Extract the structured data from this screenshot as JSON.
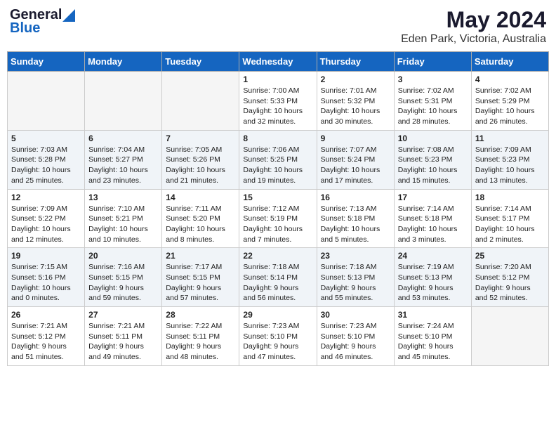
{
  "logo": {
    "general": "General",
    "blue": "Blue"
  },
  "title": "May 2024",
  "subtitle": "Eden Park, Victoria, Australia",
  "weekdays": [
    "Sunday",
    "Monday",
    "Tuesday",
    "Wednesday",
    "Thursday",
    "Friday",
    "Saturday"
  ],
  "weeks": [
    [
      {
        "day": "",
        "info": ""
      },
      {
        "day": "",
        "info": ""
      },
      {
        "day": "",
        "info": ""
      },
      {
        "day": "1",
        "info": "Sunrise: 7:00 AM\nSunset: 5:33 PM\nDaylight: 10 hours\nand 32 minutes."
      },
      {
        "day": "2",
        "info": "Sunrise: 7:01 AM\nSunset: 5:32 PM\nDaylight: 10 hours\nand 30 minutes."
      },
      {
        "day": "3",
        "info": "Sunrise: 7:02 AM\nSunset: 5:31 PM\nDaylight: 10 hours\nand 28 minutes."
      },
      {
        "day": "4",
        "info": "Sunrise: 7:02 AM\nSunset: 5:29 PM\nDaylight: 10 hours\nand 26 minutes."
      }
    ],
    [
      {
        "day": "5",
        "info": "Sunrise: 7:03 AM\nSunset: 5:28 PM\nDaylight: 10 hours\nand 25 minutes."
      },
      {
        "day": "6",
        "info": "Sunrise: 7:04 AM\nSunset: 5:27 PM\nDaylight: 10 hours\nand 23 minutes."
      },
      {
        "day": "7",
        "info": "Sunrise: 7:05 AM\nSunset: 5:26 PM\nDaylight: 10 hours\nand 21 minutes."
      },
      {
        "day": "8",
        "info": "Sunrise: 7:06 AM\nSunset: 5:25 PM\nDaylight: 10 hours\nand 19 minutes."
      },
      {
        "day": "9",
        "info": "Sunrise: 7:07 AM\nSunset: 5:24 PM\nDaylight: 10 hours\nand 17 minutes."
      },
      {
        "day": "10",
        "info": "Sunrise: 7:08 AM\nSunset: 5:23 PM\nDaylight: 10 hours\nand 15 minutes."
      },
      {
        "day": "11",
        "info": "Sunrise: 7:09 AM\nSunset: 5:23 PM\nDaylight: 10 hours\nand 13 minutes."
      }
    ],
    [
      {
        "day": "12",
        "info": "Sunrise: 7:09 AM\nSunset: 5:22 PM\nDaylight: 10 hours\nand 12 minutes."
      },
      {
        "day": "13",
        "info": "Sunrise: 7:10 AM\nSunset: 5:21 PM\nDaylight: 10 hours\nand 10 minutes."
      },
      {
        "day": "14",
        "info": "Sunrise: 7:11 AM\nSunset: 5:20 PM\nDaylight: 10 hours\nand 8 minutes."
      },
      {
        "day": "15",
        "info": "Sunrise: 7:12 AM\nSunset: 5:19 PM\nDaylight: 10 hours\nand 7 minutes."
      },
      {
        "day": "16",
        "info": "Sunrise: 7:13 AM\nSunset: 5:18 PM\nDaylight: 10 hours\nand 5 minutes."
      },
      {
        "day": "17",
        "info": "Sunrise: 7:14 AM\nSunset: 5:18 PM\nDaylight: 10 hours\nand 3 minutes."
      },
      {
        "day": "18",
        "info": "Sunrise: 7:14 AM\nSunset: 5:17 PM\nDaylight: 10 hours\nand 2 minutes."
      }
    ],
    [
      {
        "day": "19",
        "info": "Sunrise: 7:15 AM\nSunset: 5:16 PM\nDaylight: 10 hours\nand 0 minutes."
      },
      {
        "day": "20",
        "info": "Sunrise: 7:16 AM\nSunset: 5:15 PM\nDaylight: 9 hours\nand 59 minutes."
      },
      {
        "day": "21",
        "info": "Sunrise: 7:17 AM\nSunset: 5:15 PM\nDaylight: 9 hours\nand 57 minutes."
      },
      {
        "day": "22",
        "info": "Sunrise: 7:18 AM\nSunset: 5:14 PM\nDaylight: 9 hours\nand 56 minutes."
      },
      {
        "day": "23",
        "info": "Sunrise: 7:18 AM\nSunset: 5:13 PM\nDaylight: 9 hours\nand 55 minutes."
      },
      {
        "day": "24",
        "info": "Sunrise: 7:19 AM\nSunset: 5:13 PM\nDaylight: 9 hours\nand 53 minutes."
      },
      {
        "day": "25",
        "info": "Sunrise: 7:20 AM\nSunset: 5:12 PM\nDaylight: 9 hours\nand 52 minutes."
      }
    ],
    [
      {
        "day": "26",
        "info": "Sunrise: 7:21 AM\nSunset: 5:12 PM\nDaylight: 9 hours\nand 51 minutes."
      },
      {
        "day": "27",
        "info": "Sunrise: 7:21 AM\nSunset: 5:11 PM\nDaylight: 9 hours\nand 49 minutes."
      },
      {
        "day": "28",
        "info": "Sunrise: 7:22 AM\nSunset: 5:11 PM\nDaylight: 9 hours\nand 48 minutes."
      },
      {
        "day": "29",
        "info": "Sunrise: 7:23 AM\nSunset: 5:10 PM\nDaylight: 9 hours\nand 47 minutes."
      },
      {
        "day": "30",
        "info": "Sunrise: 7:23 AM\nSunset: 5:10 PM\nDaylight: 9 hours\nand 46 minutes."
      },
      {
        "day": "31",
        "info": "Sunrise: 7:24 AM\nSunset: 5:10 PM\nDaylight: 9 hours\nand 45 minutes."
      },
      {
        "day": "",
        "info": ""
      }
    ]
  ]
}
